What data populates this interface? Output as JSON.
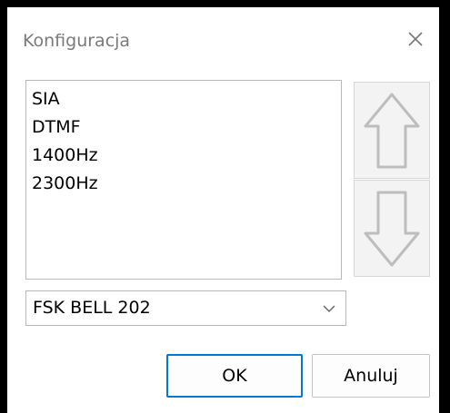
{
  "dialog": {
    "title": "Konfiguracja",
    "close_icon": "close-icon"
  },
  "list": {
    "items": [
      "SIA",
      "DTMF",
      "1400Hz",
      "2300Hz"
    ]
  },
  "side_buttons": {
    "up_icon": "arrow-up-icon",
    "down_icon": "arrow-down-icon"
  },
  "combo": {
    "value": "FSK BELL 202",
    "arrow_icon": "chevron-down-icon"
  },
  "buttons": {
    "ok": "OK",
    "cancel": "Anuluj"
  },
  "colors": {
    "accent": "#0078d4",
    "title_text": "#7a7a7a",
    "disabled_arrow": "#bdbdbd"
  }
}
